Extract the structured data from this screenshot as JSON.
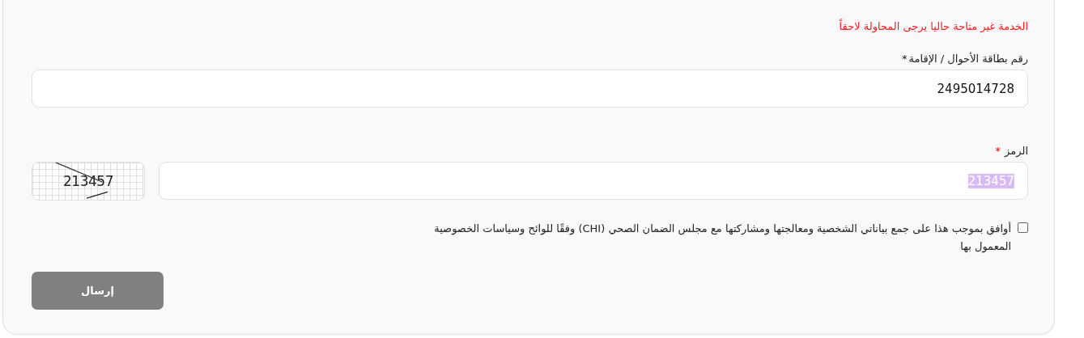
{
  "error_message": "الخدمة غير متاحة حاليا يرجى المحاولة لاحقاً",
  "id_field": {
    "label": "رقم بطاقة الأحوال / الإقامة",
    "required_mark": "*",
    "value": "2495014728"
  },
  "code_field": {
    "label": "الرمز",
    "required_mark": "*",
    "value": "213457",
    "value_selected": true
  },
  "captcha": {
    "text": "213457"
  },
  "consent": {
    "checked": false,
    "text": "أوافق بموجب هذا على جمع بياناتي الشخصية ومعالجتها ومشاركتها مع مجلس الضمان الصحي (CHI) وفقًا للوائح وسياسات الخصوصية المعمول بها"
  },
  "submit_button": {
    "label": "إرسال",
    "disabled": true
  }
}
